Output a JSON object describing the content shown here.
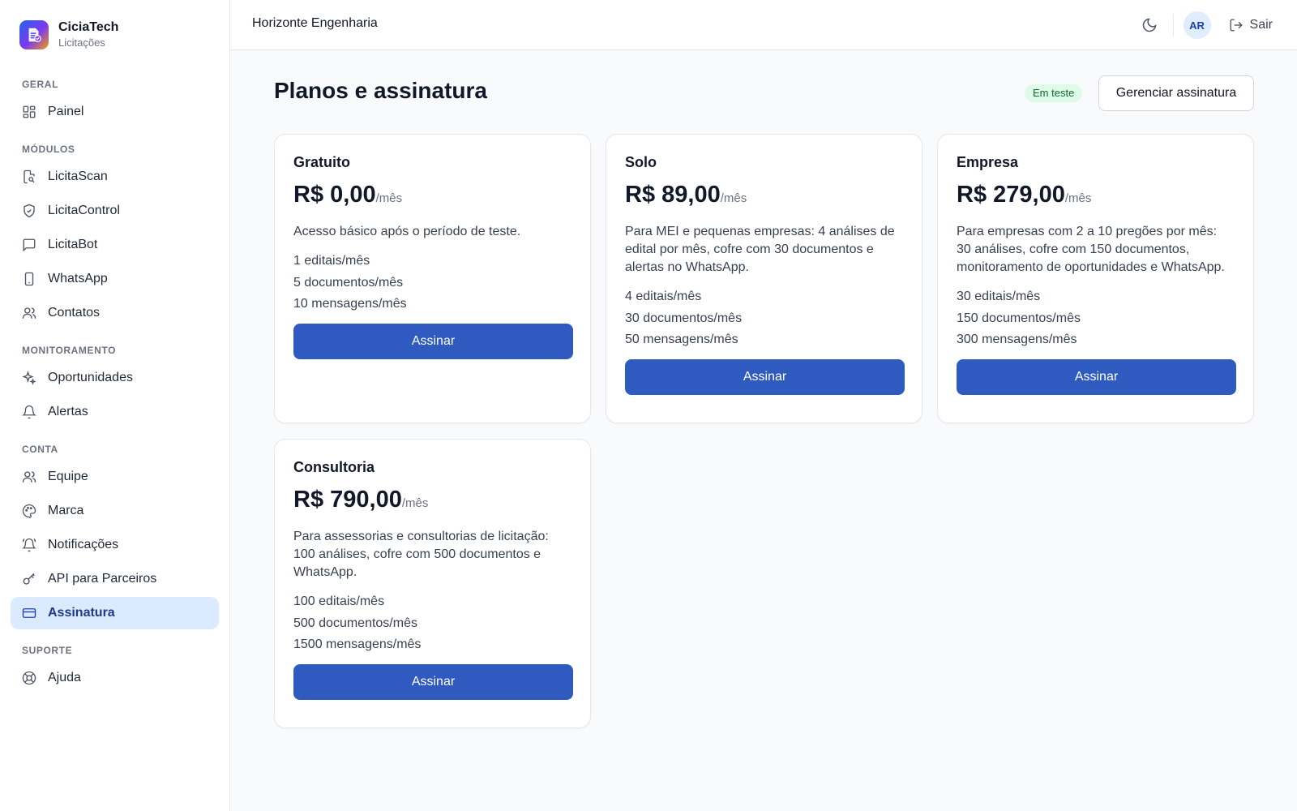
{
  "brand": {
    "name": "CiciaTech",
    "subtitle": "Licitações"
  },
  "sidebar": {
    "sections": [
      {
        "title": "GERAL",
        "items": [
          {
            "label": "Painel",
            "icon": "dashboard-icon"
          }
        ]
      },
      {
        "title": "MÓDULOS",
        "items": [
          {
            "label": "LicitaScan",
            "icon": "file-search-icon"
          },
          {
            "label": "LicitaControl",
            "icon": "shield-icon"
          },
          {
            "label": "LicitaBot",
            "icon": "message-icon"
          },
          {
            "label": "WhatsApp",
            "icon": "phone-icon"
          },
          {
            "label": "Contatos",
            "icon": "users-icon"
          }
        ]
      },
      {
        "title": "MONITORAMENTO",
        "items": [
          {
            "label": "Oportunidades",
            "icon": "sparkles-icon"
          },
          {
            "label": "Alertas",
            "icon": "bell-icon"
          }
        ]
      },
      {
        "title": "CONTA",
        "items": [
          {
            "label": "Equipe",
            "icon": "users-icon"
          },
          {
            "label": "Marca",
            "icon": "palette-icon"
          },
          {
            "label": "Notificações",
            "icon": "bell-ring-icon"
          },
          {
            "label": "API para Parceiros",
            "icon": "key-icon"
          },
          {
            "label": "Assinatura",
            "icon": "credit-card-icon",
            "active": true
          }
        ]
      },
      {
        "title": "SUPORTE",
        "items": [
          {
            "label": "Ajuda",
            "icon": "lifebuoy-icon"
          }
        ]
      }
    ]
  },
  "topbar": {
    "org_name": "Horizonte Engenharia",
    "avatar_initials": "AR",
    "logout_label": "Sair"
  },
  "page": {
    "title": "Planos e assinatura",
    "trial_badge": "Em teste",
    "manage_button": "Gerenciar assinatura"
  },
  "plans": [
    {
      "name": "Gratuito",
      "price": "R$ 0,00",
      "period": "/mês",
      "description": "Acesso básico após o período de teste.",
      "limits": [
        "1 editais/mês",
        "5 documentos/mês",
        "10 mensagens/mês"
      ],
      "button": "Assinar"
    },
    {
      "name": "Solo",
      "price": "R$ 89,00",
      "period": "/mês",
      "description": "Para MEI e pequenas empresas: 4 análises de edital por mês, cofre com 30 documentos e alertas no WhatsApp.",
      "limits": [
        "4 editais/mês",
        "30 documentos/mês",
        "50 mensagens/mês"
      ],
      "button": "Assinar"
    },
    {
      "name": "Empresa",
      "price": "R$ 279,00",
      "period": "/mês",
      "description": "Para empresas com 2 a 10 pregões por mês: 30 análises, cofre com 150 documentos, monitoramento de oportunidades e WhatsApp.",
      "limits": [
        "30 editais/mês",
        "150 documentos/mês",
        "300 mensagens/mês"
      ],
      "button": "Assinar"
    },
    {
      "name": "Consultoria",
      "price": "R$ 790,00",
      "period": "/mês",
      "description": "Para assessorias e consultorias de licitação: 100 análises, cofre com 500 documentos e WhatsApp.",
      "limits": [
        "100 editais/mês",
        "500 documentos/mês",
        "1500 mensagens/mês"
      ],
      "button": "Assinar"
    }
  ],
  "colors": {
    "primary": "#2f5bc1",
    "active_bg": "#dbeafe",
    "badge_bg": "#dcfce7",
    "badge_text": "#166534"
  }
}
